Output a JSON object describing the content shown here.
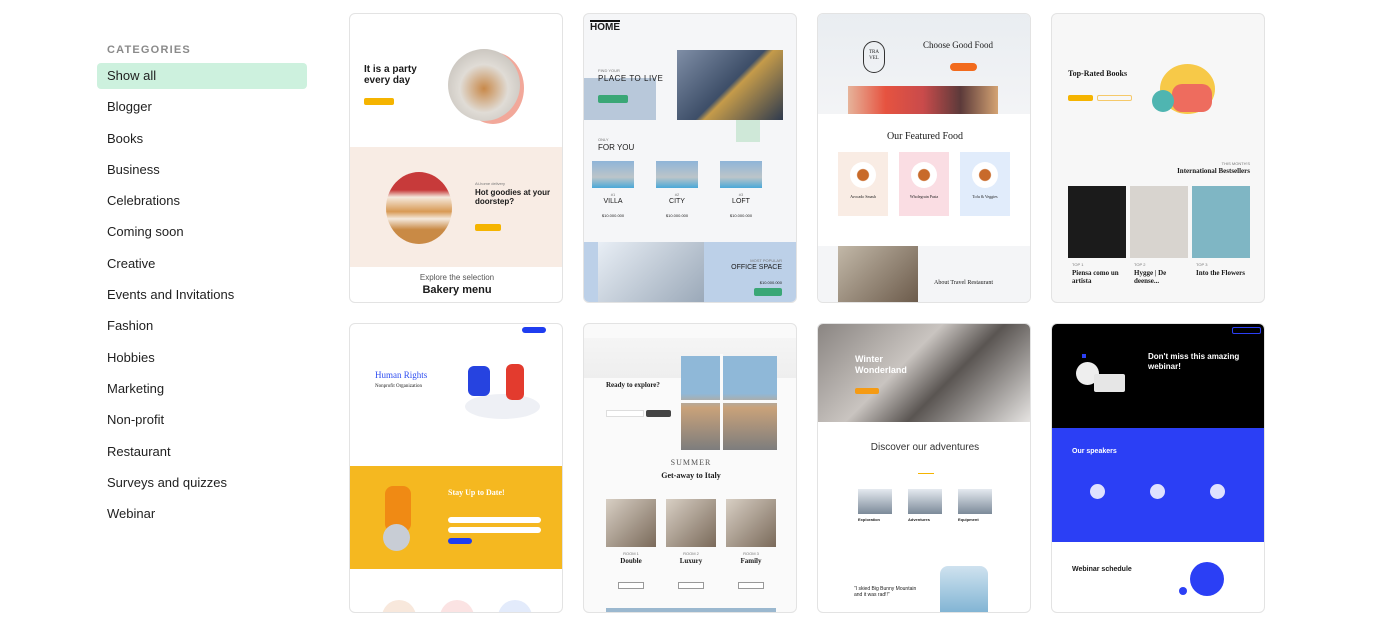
{
  "sidebar": {
    "title": "CATEGORIES",
    "items": [
      {
        "label": "Show all",
        "active": true
      },
      {
        "label": "Blogger"
      },
      {
        "label": "Books"
      },
      {
        "label": "Business"
      },
      {
        "label": "Celebrations"
      },
      {
        "label": "Coming soon"
      },
      {
        "label": "Creative"
      },
      {
        "label": "Events and Invitations"
      },
      {
        "label": "Fashion"
      },
      {
        "label": "Hobbies"
      },
      {
        "label": "Marketing"
      },
      {
        "label": "Non-profit"
      },
      {
        "label": "Restaurant"
      },
      {
        "label": "Surveys and quizzes"
      },
      {
        "label": "Webinar"
      }
    ]
  },
  "colors": {
    "active_category_bg": "#cdf1de",
    "webinar_blue": "#2b3ff5",
    "stay_yellow": "#f5b820"
  },
  "templates": [
    {
      "headline": "It is a party every day",
      "section_kicker": "At-home delivery",
      "section_title": "Hot goodies at your doorstep?",
      "footer_kicker": "Explore the selection",
      "footer_title": "Bakery menu"
    },
    {
      "logo": "HOME",
      "kicker": "FIND YOUR",
      "headline": "PLACE TO LIVE",
      "only": "ONLY",
      "for_you": "FOR YOU",
      "listings": [
        {
          "num": "#1",
          "name": "VILLA",
          "price": "$10.000.000"
        },
        {
          "num": "#2",
          "name": "CITY",
          "price": "$10.000.000"
        },
        {
          "num": "#3",
          "name": "LOFT",
          "price": "$10.000.000"
        }
      ],
      "popular_kicker": "MOST POPULAR",
      "popular_title": "OFFICE SPACE",
      "popular_price": "$10.000.000"
    },
    {
      "logo": "TRA VEL",
      "headline": "Choose Good Food",
      "featured": "Our Featured Food",
      "dishes": [
        "Avocado Smash",
        "Wholegrain Pasta",
        "Tofu & Veggies"
      ],
      "about": "About Travel Restaurant"
    },
    {
      "headline": "Top-Rated Books",
      "kicker": "THIS MONTH'S",
      "section": "International Bestsellers",
      "books": [
        {
          "rank": "TOP 1",
          "title": "Piensa como un artista"
        },
        {
          "rank": "TOP 2",
          "title": "Hygge | De deense..."
        },
        {
          "rank": "TOP 3",
          "title": "Into the Flowers"
        }
      ]
    },
    {
      "headline": "Human Rights",
      "subtitle": "Nonprofit Organization",
      "newsletter": "Stay Up to Date!"
    },
    {
      "headline": "Ready to explore?",
      "kicker": "SUMMER",
      "section": "Get-away to Italy",
      "rooms": [
        {
          "num": "ROOM 1",
          "name": "Double"
        },
        {
          "num": "ROOM 2",
          "name": "Luxury"
        },
        {
          "num": "ROOM 3",
          "name": "Family"
        }
      ]
    },
    {
      "headline": "Winter Wonderland",
      "section": "Discover our adventures",
      "items": [
        "Exploration",
        "Adventures",
        "Equipment"
      ],
      "quote": "“I skied Big Bunny Mountain and it was rad!!”"
    },
    {
      "headline": "Don't miss this amazing webinar!",
      "speakers": "Our speakers",
      "schedule": "Webinar schedule"
    }
  ]
}
